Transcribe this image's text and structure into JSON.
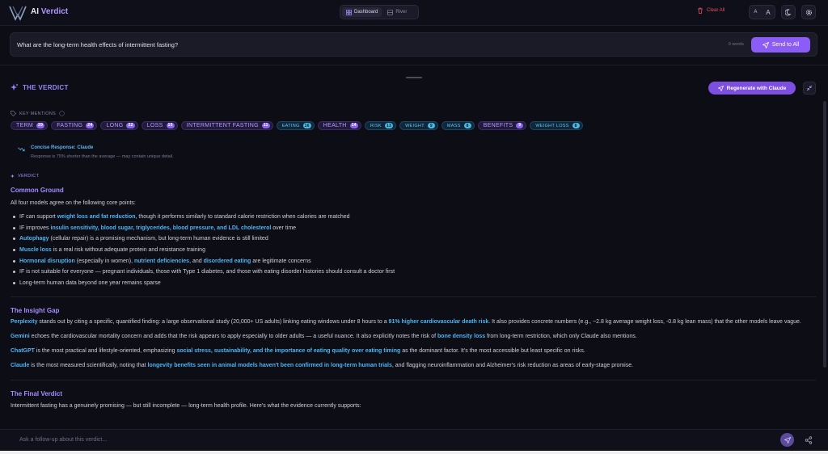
{
  "app": {
    "name_prefix": "AI",
    "name_suffix": "Verdict",
    "logo_icon": "v-logo-icon"
  },
  "view_toggle": [
    {
      "label": "Dashboard",
      "icon": "grid-icon",
      "active": true
    },
    {
      "label": "River",
      "icon": "river-icon",
      "active": false
    }
  ],
  "toolbar": {
    "clear_label": "Clear All",
    "font_small": "A",
    "font_large": "A"
  },
  "prompt": {
    "text": "What are the long-term health effects of intermittent fasting?",
    "word_count": "9 words",
    "send_label": "Send to All"
  },
  "verdict": {
    "title": "THE VERDICT",
    "regenerate_label": "Regenerate with Claude"
  },
  "key_mentions": {
    "label": "KEY MENTIONS",
    "chips": [
      {
        "label": "TERM",
        "count": "29",
        "color": "p"
      },
      {
        "label": "FASTING",
        "count": "24",
        "color": "p"
      },
      {
        "label": "LONG",
        "count": "22",
        "color": "p"
      },
      {
        "label": "LOSS",
        "count": "15",
        "color": "p"
      },
      {
        "label": "INTERMITTENT FASTING",
        "count": "11",
        "color": "p"
      },
      {
        "label": "EATING",
        "count": "16",
        "color": "t"
      },
      {
        "label": "HEALTH",
        "count": "14",
        "color": "p"
      },
      {
        "label": "RISK",
        "count": "13",
        "color": "t"
      },
      {
        "label": "WEIGHT",
        "count": "9",
        "color": "t"
      },
      {
        "label": "MASS",
        "count": "8",
        "color": "t"
      },
      {
        "label": "BENEFITS",
        "count": "9",
        "color": "p"
      },
      {
        "label": "WEIGHT LOSS",
        "count": "8",
        "color": "t"
      }
    ]
  },
  "concise": {
    "title": "Concise Response: Claude",
    "subtitle": "Response is 75% shorter than the average — may contain unique detail."
  },
  "verdict_label": "VERDICT",
  "sections": {
    "common_ground": {
      "heading": "Common Ground",
      "intro": "All four models agree on the following core points:"
    },
    "insight_gap": {
      "heading": "The Insight Gap"
    },
    "final_verdict": {
      "heading": "The Final Verdict",
      "intro": "Intermittent fasting has a genuinely promising — but still incomplete — long-term health profile. Here's what the evidence currently supports:"
    }
  },
  "follow_up": {
    "placeholder": "Ask a follow-up about this verdict..."
  },
  "colors": {
    "accent": "#8b5cf6",
    "highlight": "#4fb4f0",
    "danger": "#e4505e",
    "background": "#0d0d16"
  }
}
